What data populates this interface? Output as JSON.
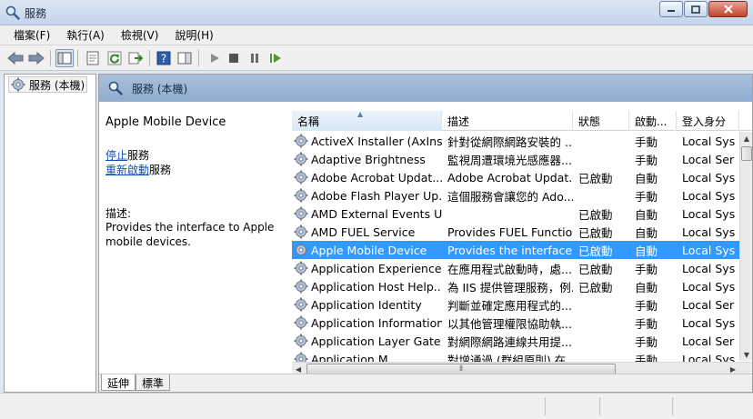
{
  "window": {
    "title": "服務",
    "icon": "services-magnifier-icon"
  },
  "menu": [
    "檔案(F)",
    "執行(A)",
    "檢視(V)",
    "說明(H)"
  ],
  "toolbar": {
    "buttons": [
      "back-arrow-icon",
      "forward-arrow-icon",
      "show-hide-tree-icon",
      "properties-icon",
      "refresh-icon",
      "export-list-icon",
      "help-icon",
      "action-pane-icon",
      "start-service-icon",
      "stop-service-icon",
      "pause-service-icon",
      "restart-service-icon"
    ]
  },
  "tree": {
    "item_label": "服務 (本機)"
  },
  "header": {
    "title": "服務 (本機)"
  },
  "details": {
    "service_name": "Apple Mobile Device",
    "stop_link": "停止",
    "stop_suffix": "服務",
    "restart_link": "重新啟動",
    "restart_suffix": "服務",
    "description_label": "描述:",
    "description_text": "Provides the interface to Apple mobile devices."
  },
  "columns": {
    "name": "名稱",
    "description": "描述",
    "status": "狀態",
    "startup": "啟動...",
    "logon": "登入身分"
  },
  "rows": [
    {
      "name": "ActiveX Installer (AxInst...",
      "description": "針對從網際網路安裝的 ...",
      "status": "",
      "startup": "手動",
      "logon": "Local Sys"
    },
    {
      "name": "Adaptive Brightness",
      "description": "監視周遭環境光感應器...",
      "status": "",
      "startup": "手動",
      "logon": "Local Ser"
    },
    {
      "name": "Adobe Acrobat Updat...",
      "description": "Adobe Acrobat Updat...",
      "status": "已啟動",
      "startup": "自動",
      "logon": "Local Sys"
    },
    {
      "name": "Adobe Flash Player Up...",
      "description": "這個服務會讓您的 Ado...",
      "status": "",
      "startup": "手動",
      "logon": "Local Sys"
    },
    {
      "name": "AMD External Events U...",
      "description": "",
      "status": "已啟動",
      "startup": "自動",
      "logon": "Local Sys"
    },
    {
      "name": "AMD FUEL Service",
      "description": "Provides FUEL Functio...",
      "status": "已啟動",
      "startup": "自動",
      "logon": "Local Sys"
    },
    {
      "name": "Apple Mobile Device",
      "description": "Provides the interface ...",
      "status": "已啟動",
      "startup": "自動",
      "logon": "Local Sys",
      "selected": true
    },
    {
      "name": "Application Experience",
      "description": "在應用程式啟動時，處...",
      "status": "已啟動",
      "startup": "手動",
      "logon": "Local Sys"
    },
    {
      "name": "Application Host Help...",
      "description": "為 IIS 提供管理服務，例...",
      "status": "已啟動",
      "startup": "自動",
      "logon": "Local Sys"
    },
    {
      "name": "Application Identity",
      "description": "判斷並確定應用程式的...",
      "status": "",
      "startup": "手動",
      "logon": "Local Ser"
    },
    {
      "name": "Application Information",
      "description": "以其他管理權限協助執...",
      "status": "",
      "startup": "手動",
      "logon": "Local Sys"
    },
    {
      "name": "Application Layer Gate...",
      "description": "對網際網路連線共用提...",
      "status": "",
      "startup": "手動",
      "logon": "Local Ser"
    },
    {
      "name": "Application M...",
      "description": "對增通過 (群組原則) 在...",
      "status": "",
      "startup": "手動",
      "logon": "Local Sys"
    }
  ],
  "tabs": [
    "延伸",
    "標準"
  ]
}
